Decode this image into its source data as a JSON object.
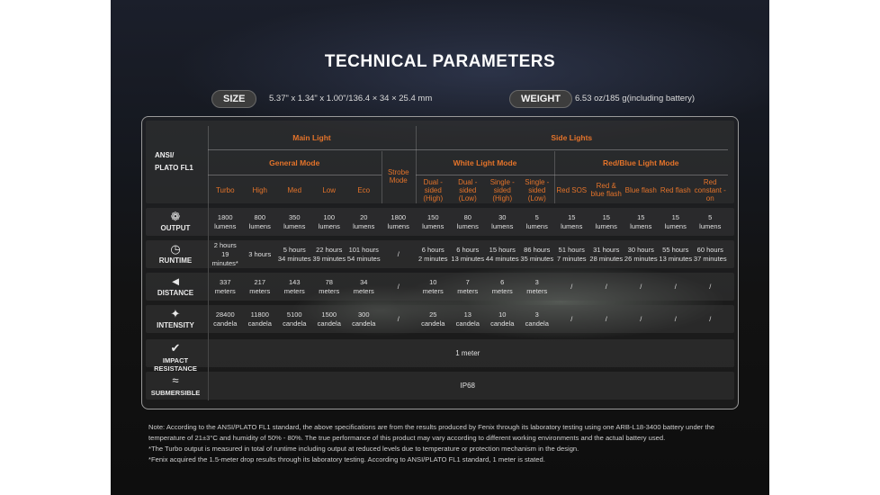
{
  "title": "TECHNICAL PARAMETERS",
  "size": {
    "label": "SIZE",
    "value": "5.37\" x 1.34\" x 1.00\"/136.4 × 34 × 25.4 mm"
  },
  "weight": {
    "label": "WEIGHT",
    "value": "6.53 oz/185 g(including battery)"
  },
  "table": {
    "standard_line1": "ANSI/",
    "standard_line2": "PLATO FL1",
    "main_light": "Main Light",
    "side_lights": "Side Lights",
    "general_mode": "General Mode",
    "strobe_mode": "Strobe Mode",
    "white_light_mode": "White Light Mode",
    "red_blue_mode": "Red/Blue Light Mode",
    "modes": [
      "Turbo",
      "High",
      "Med",
      "Low",
      "Eco",
      "",
      "Dual -sided (High)",
      "Dual -sided (Low)",
      "Single -sided (High)",
      "Single -sided (Low)",
      "Red SOS",
      "Red & blue flash",
      "Blue flash",
      "Red flash",
      "Red constant -on"
    ],
    "rows": [
      {
        "label": "OUTPUT",
        "icon": "burst-icon",
        "cells": [
          [
            "1800",
            "lumens"
          ],
          [
            "800",
            "lumens"
          ],
          [
            "350",
            "lumens"
          ],
          [
            "100",
            "lumens"
          ],
          [
            "20",
            "lumens"
          ],
          [
            "1800",
            "lumens"
          ],
          [
            "150",
            "lumens"
          ],
          [
            "80",
            "lumens"
          ],
          [
            "30",
            "lumens"
          ],
          [
            "5",
            "lumens"
          ],
          [
            "15",
            "lumens"
          ],
          [
            "15",
            "lumens"
          ],
          [
            "15",
            "lumens"
          ],
          [
            "15",
            "lumens"
          ],
          [
            "5",
            "lumens"
          ]
        ]
      },
      {
        "label": "RUNTIME",
        "icon": "clock-icon",
        "cells": [
          [
            "2 hours",
            "19 minutes*"
          ],
          [
            "3 hours",
            ""
          ],
          [
            "5 hours",
            "34 minutes"
          ],
          [
            "22 hours",
            "39 minutes"
          ],
          [
            "101 hours",
            "54 minutes"
          ],
          [
            "/",
            ""
          ],
          [
            "6 hours",
            "2 minutes"
          ],
          [
            "6 hours",
            "13 minutes"
          ],
          [
            "15 hours",
            "44 minutes"
          ],
          [
            "86 hours",
            "35 minutes"
          ],
          [
            "51 hours",
            "7 minutes"
          ],
          [
            "31 hours",
            "28 minutes"
          ],
          [
            "30 hours",
            "26 minutes"
          ],
          [
            "55 hours",
            "13 minutes"
          ],
          [
            "60 hours",
            "37 minutes"
          ]
        ]
      },
      {
        "label": "DISTANCE",
        "icon": "beam-icon",
        "cells": [
          [
            "337",
            "meters"
          ],
          [
            "217",
            "meters"
          ],
          [
            "143",
            "meters"
          ],
          [
            "78",
            "meters"
          ],
          [
            "34",
            "meters"
          ],
          [
            "/",
            ""
          ],
          [
            "10",
            "meters"
          ],
          [
            "7",
            "meters"
          ],
          [
            "6",
            "meters"
          ],
          [
            "3",
            "meters"
          ],
          [
            "/",
            ""
          ],
          [
            "/",
            ""
          ],
          [
            "/",
            ""
          ],
          [
            "/",
            ""
          ],
          [
            "/",
            ""
          ]
        ]
      },
      {
        "label": "INTENSITY",
        "icon": "star-icon",
        "cells": [
          [
            "28400",
            "candela"
          ],
          [
            "11800",
            "candela"
          ],
          [
            "5100",
            "candela"
          ],
          [
            "1500",
            "candela"
          ],
          [
            "300",
            "candela"
          ],
          [
            "/",
            ""
          ],
          [
            "25",
            "candela"
          ],
          [
            "13",
            "candela"
          ],
          [
            "10",
            "candela"
          ],
          [
            "3",
            "candela"
          ],
          [
            "/",
            ""
          ],
          [
            "/",
            ""
          ],
          [
            "/",
            ""
          ],
          [
            "/",
            ""
          ],
          [
            "/",
            ""
          ]
        ]
      }
    ],
    "impact": {
      "label": "IMPACT RESISTANCE",
      "icon": "impact-icon",
      "value": "1 meter"
    },
    "submersible": {
      "label": "SUBMERSIBLE",
      "icon": "water-icon",
      "value": "IP68"
    }
  },
  "notes": [
    "Note: According to the ANSI/PLATO FL1 standard, the above specifications are from the results produced by Fenix through its laboratory testing using one ARB-L18-3400 battery under the temperature of 21±3°C and humidity of 50% - 80%. The true performance of this product may vary according to different working environments and the actual battery used.",
    "*The Turbo output is measured in total of runtime including output at reduced levels due to temperature or protection mechanism in the design.",
    "*Fenix acquired the 1.5-meter drop results through its laboratory testing. According to ANSI/PLATO FL1 standard, 1 meter is stated."
  ]
}
